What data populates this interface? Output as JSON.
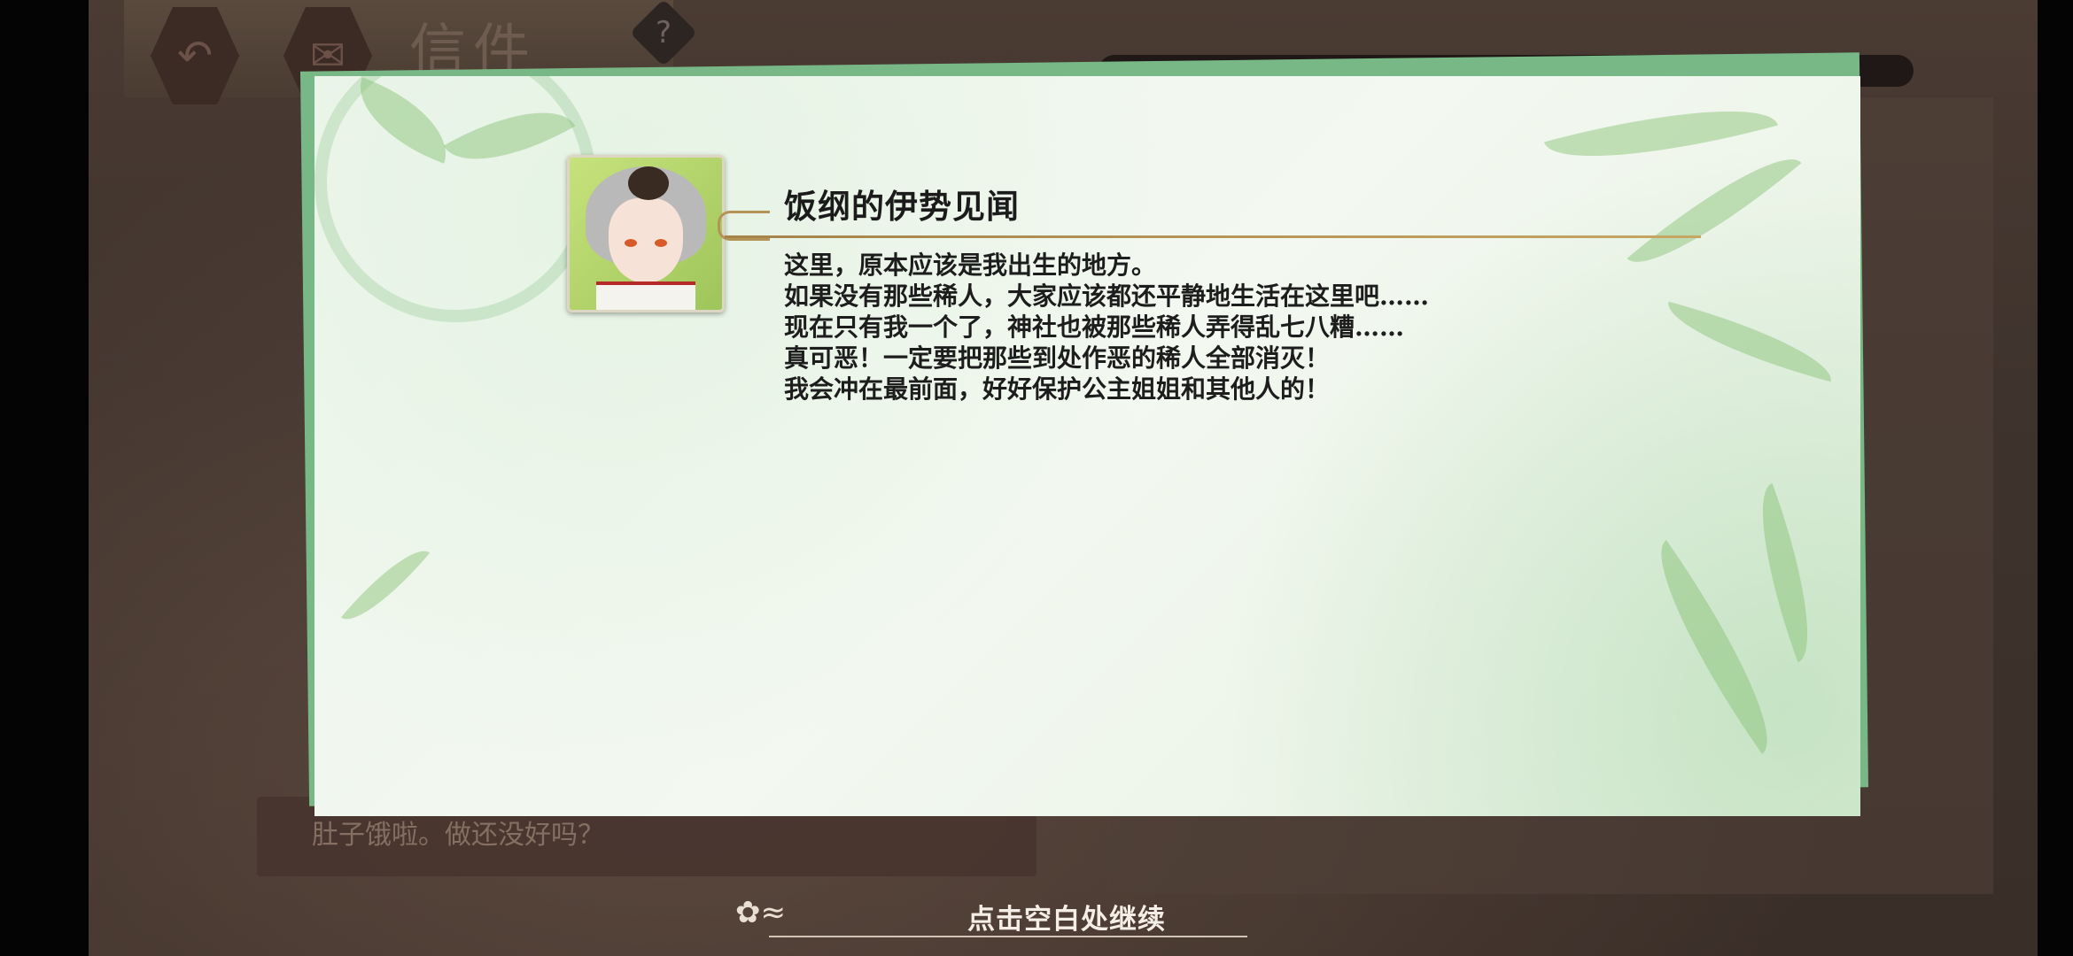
{
  "background": {
    "header_title": "信件",
    "help_label": "?",
    "dialog_text": "肚子饿啦。做还没好吗？"
  },
  "letter": {
    "title": "饭纲的伊势见闻",
    "lines": [
      "这里，原本应该是我出生的地方。",
      "如果没有那些稀人，大家应该都还平静地生活在这里吧……",
      "现在只有我一个了，神社也被那些稀人弄得乱七八糟……",
      "真可恶！一定要把那些到处作恶的稀人全部消灭！",
      "我会冲在最前面，好好保护公主姐姐和其他人的！"
    ]
  },
  "footer": {
    "continue_hint": "点击空白处继续"
  },
  "colors": {
    "letter_bg": "#f1f7ee",
    "letter_border": "#78b786",
    "title_rule": "#b49456",
    "text": "#1d1d1d",
    "hint_text": "#f4eee6"
  },
  "icons": {
    "back": "back-arrow-icon",
    "mail": "mail-icon",
    "help": "help-icon",
    "ornament": "flower-swirl-icon"
  }
}
